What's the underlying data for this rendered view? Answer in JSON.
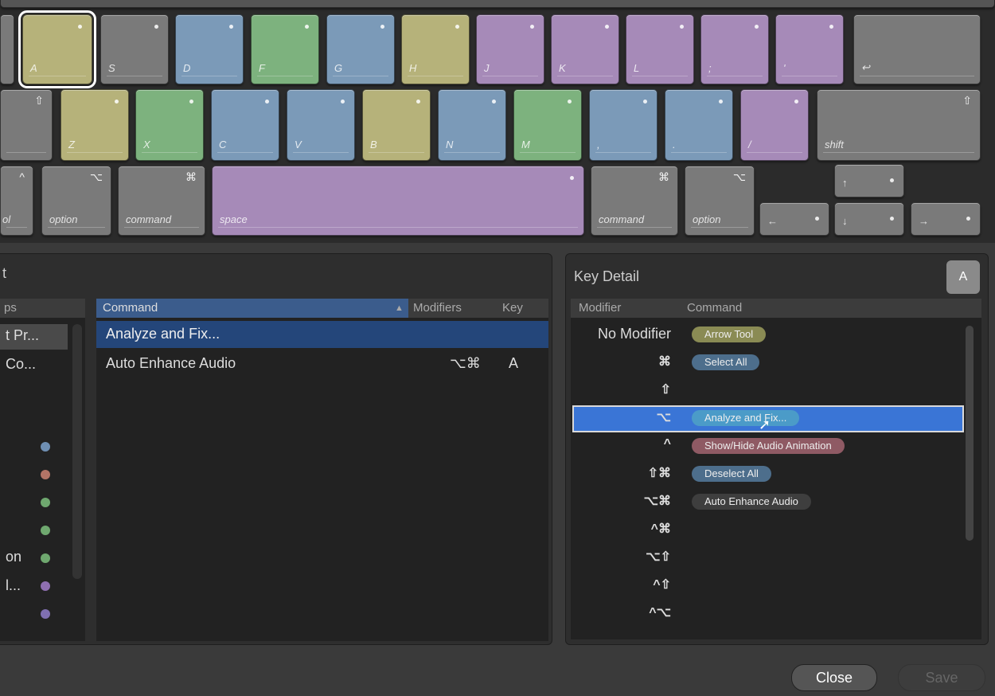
{
  "keyboard": {
    "row_home": [
      "A",
      "S",
      "D",
      "F",
      "G",
      "H",
      "J",
      "K",
      "L",
      ";",
      "'"
    ],
    "return_symbol": "↩",
    "row_bottom": [
      "Z",
      "X",
      "C",
      "V",
      "B",
      "N",
      "M",
      ",",
      ".",
      "/"
    ],
    "shift_left_symbol": "⇧",
    "shift_right_label": "shift",
    "shift_right_symbol": "⇧",
    "ctrl_label": "ol",
    "ctrl_symbol": "^",
    "option_label": "option",
    "option_symbol": "⌥",
    "command_label": "command",
    "command_symbol": "⌘",
    "space_label": "space",
    "arrow_up": "↑",
    "arrow_left": "←",
    "arrow_down": "↓",
    "arrow_right": "→"
  },
  "left_panel": {
    "title_fragment": "t",
    "groups_header": "ps",
    "groups": [
      "t Pr...",
      " Co..."
    ],
    "group_items": [
      "",
      "",
      "",
      "",
      "on",
      "l...",
      ""
    ],
    "dot_colors": [
      "#6f8fb3",
      "#b37466",
      "#6fa86f",
      "#6fa86f",
      "#6fa86f",
      "#8f6fb0",
      "#7f6fb0"
    ],
    "command_header": "Command",
    "modifiers_header": "Modifiers",
    "key_header": "Key",
    "commands": [
      {
        "name": "Analyze and Fix...",
        "modifiers": "",
        "key": ""
      },
      {
        "name": "Auto Enhance Audio",
        "modifiers": "⌥⌘",
        "key": "A"
      }
    ]
  },
  "key_detail": {
    "title": "Key Detail",
    "key_badge": "A",
    "modifier_header": "Modifier",
    "command_header": "Command",
    "rows": [
      {
        "modifier": "No Modifier",
        "command": "Arrow Tool",
        "color": "#8a8b54"
      },
      {
        "modifier": "⌘",
        "command": "Select All",
        "color": "#4d6e8c"
      },
      {
        "modifier": "⇧",
        "command": "",
        "color": ""
      },
      {
        "modifier": "⌥",
        "command": "Analyze and Fix...",
        "color": "#4b9bc8"
      },
      {
        "modifier": "^",
        "command": "Show/Hide Audio Animation",
        "color": "#8f5a64"
      },
      {
        "modifier": "⇧⌘",
        "command": "Deselect All",
        "color": "#4d6e8c"
      },
      {
        "modifier": "⌥⌘",
        "command": "Auto Enhance Audio",
        "color": "#3e3e3e"
      },
      {
        "modifier": "^⌘",
        "command": "",
        "color": ""
      },
      {
        "modifier": "⌥⇧",
        "command": "",
        "color": ""
      },
      {
        "modifier": "^⇧",
        "command": "",
        "color": ""
      },
      {
        "modifier": "^⌥",
        "command": "",
        "color": ""
      }
    ]
  },
  "buttons": {
    "close": "Close",
    "save": "Save"
  }
}
